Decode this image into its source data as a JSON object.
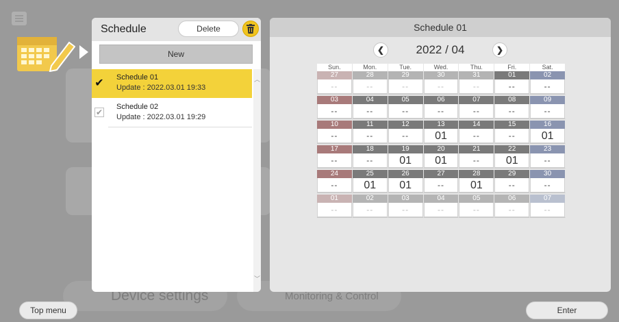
{
  "background": {
    "device_settings": "Device settings",
    "monitoring": "Monitoring & Control"
  },
  "list": {
    "title": "Schedule",
    "delete_label": "Delete",
    "new_label": "New",
    "items": [
      {
        "name": "Schedule 01",
        "update": "Update : 2022.03.01  19:33",
        "selected": true
      },
      {
        "name": "Schedule 02",
        "update": "Update : 2022.03.01  19:29",
        "selected": false
      }
    ]
  },
  "calendar": {
    "title": "Schedule 01",
    "month": "2022 / 04",
    "prev_icon": "chevron-left-icon",
    "next_icon": "chevron-right-icon",
    "weekdays": [
      "Sun.",
      "Mon.",
      "Tue.",
      "Wed.",
      "Thu.",
      "Fri.",
      "Sat."
    ],
    "weeks": [
      [
        {
          "d": "27",
          "v": "--",
          "f": true
        },
        {
          "d": "28",
          "v": "--",
          "f": true
        },
        {
          "d": "29",
          "v": "--",
          "f": true
        },
        {
          "d": "30",
          "v": "--",
          "f": true
        },
        {
          "d": "31",
          "v": "--",
          "f": true
        },
        {
          "d": "01",
          "v": "--"
        },
        {
          "d": "02",
          "v": "--"
        }
      ],
      [
        {
          "d": "03",
          "v": "--"
        },
        {
          "d": "04",
          "v": "--"
        },
        {
          "d": "05",
          "v": "--"
        },
        {
          "d": "06",
          "v": "--"
        },
        {
          "d": "07",
          "v": "--"
        },
        {
          "d": "08",
          "v": "--"
        },
        {
          "d": "09",
          "v": "--"
        }
      ],
      [
        {
          "d": "10",
          "v": "--"
        },
        {
          "d": "11",
          "v": "--"
        },
        {
          "d": "12",
          "v": "--"
        },
        {
          "d": "13",
          "v": "01"
        },
        {
          "d": "14",
          "v": "--"
        },
        {
          "d": "15",
          "v": "--"
        },
        {
          "d": "16",
          "v": "01"
        }
      ],
      [
        {
          "d": "17",
          "v": "--"
        },
        {
          "d": "18",
          "v": "--"
        },
        {
          "d": "19",
          "v": "01"
        },
        {
          "d": "20",
          "v": "01"
        },
        {
          "d": "21",
          "v": "--"
        },
        {
          "d": "22",
          "v": "01"
        },
        {
          "d": "23",
          "v": "--"
        }
      ],
      [
        {
          "d": "24",
          "v": "--"
        },
        {
          "d": "25",
          "v": "01"
        },
        {
          "d": "26",
          "v": "01"
        },
        {
          "d": "27",
          "v": "--"
        },
        {
          "d": "28",
          "v": "01"
        },
        {
          "d": "29",
          "v": "--"
        },
        {
          "d": "30",
          "v": "--"
        }
      ],
      [
        {
          "d": "01",
          "v": "--",
          "f": true
        },
        {
          "d": "02",
          "v": "--",
          "f": true
        },
        {
          "d": "03",
          "v": "--",
          "f": true
        },
        {
          "d": "04",
          "v": "--",
          "f": true
        },
        {
          "d": "05",
          "v": "--",
          "f": true
        },
        {
          "d": "06",
          "v": "--",
          "f": true
        },
        {
          "d": "07",
          "v": "--",
          "f": true
        }
      ]
    ]
  },
  "footer": {
    "top_menu_label": "Top menu",
    "enter_label": "Enter"
  },
  "colors": {
    "selected_row": "#f3d23a",
    "trash_button": "#f0c420",
    "sunday_header": "#a87a7a",
    "saturday_header": "#8a94b0"
  }
}
